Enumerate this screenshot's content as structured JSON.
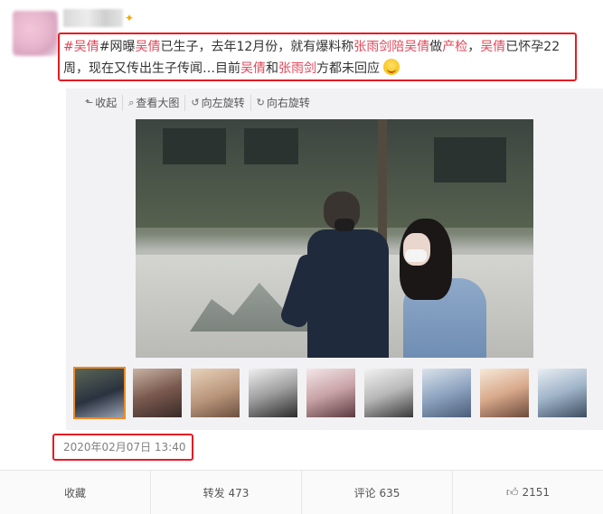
{
  "post": {
    "segments": [
      {
        "text": "#吴倩",
        "hl": true
      },
      {
        "text": "#网曝",
        "hl": false
      },
      {
        "text": "吴倩",
        "hl": true
      },
      {
        "text": "已生子，去年12月份，就有爆料称",
        "hl": false
      },
      {
        "text": "张雨剑陪吴倩",
        "hl": true
      },
      {
        "text": "做",
        "hl": false
      },
      {
        "text": "产检",
        "hl": true
      },
      {
        "text": "，",
        "hl": false
      },
      {
        "text": "吴倩",
        "hl": true
      },
      {
        "text": "已怀孕22周，现在又传出生子传闻…目前",
        "hl": false
      },
      {
        "text": "吴倩",
        "hl": true
      },
      {
        "text": "和",
        "hl": false
      },
      {
        "text": "张雨剑",
        "hl": true
      },
      {
        "text": "方都未回应",
        "hl": false
      }
    ],
    "emoji_icon": "grin-emoji-icon"
  },
  "toolbar": {
    "collapse_label": "收起",
    "view_large_label": "查看大图",
    "rotate_left_label": "向左旋转",
    "rotate_right_label": "向右旋转"
  },
  "thumbnails_count": 9,
  "timestamp": "2020年02月07日 13:40",
  "actions": {
    "favorite_label": "收藏",
    "repost_label": "转发 473",
    "comment_label": "评论 635",
    "like_count": "2151"
  },
  "colors": {
    "highlight": "#e0485a",
    "annotation_box": "#e51c23",
    "thumb_active": "#f08a24"
  }
}
